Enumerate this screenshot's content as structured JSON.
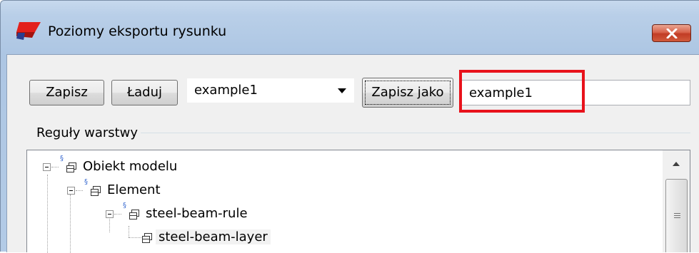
{
  "window": {
    "title": "Poziomy eksportu rysunku",
    "close_symbol": "✕",
    "icons": {
      "app": "app-icon",
      "close": "close-icon"
    }
  },
  "toolbar": {
    "save_label": "Zapisz",
    "load_label": "Ładuj",
    "preset_selected": "example1",
    "save_as_label": "Zapisz jako",
    "name_value": "example1"
  },
  "layer_rules": {
    "group_label": "Reguły warstwy",
    "tree": [
      {
        "label": "Obiekt modelu",
        "level": 0,
        "expanded": true
      },
      {
        "label": "Element",
        "level": 1,
        "expanded": true
      },
      {
        "label": "steel-beam-rule",
        "level": 2,
        "expanded": true
      },
      {
        "label": "steel-beam-layer",
        "level": 3,
        "selected": true
      }
    ],
    "rule_marker": "§"
  },
  "colors": {
    "highlight": "#e8121b",
    "titlebar": "#b9cfe8",
    "close_button": "#c13c25"
  }
}
